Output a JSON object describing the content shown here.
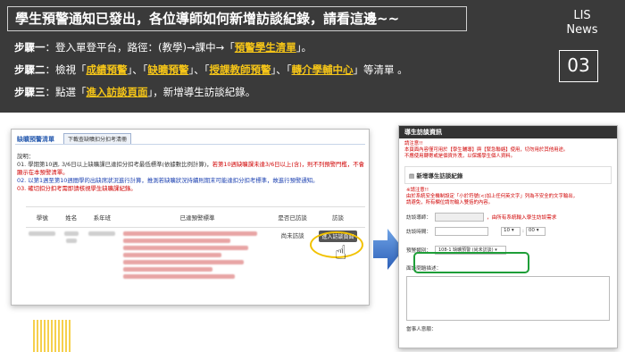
{
  "header": {
    "title": "學生預警通知已發出，各位導師如何新增訪談紀錄，請看這邊~~",
    "brand_line1": "LIS",
    "brand_line2": "News",
    "number": "03"
  },
  "steps": [
    {
      "label": "步驟一",
      "t1": "：登入單登平台，路徑：(教學)→課中→「",
      "h1": "預警學生清單",
      "t2": "」。"
    },
    {
      "label": "步驟二",
      "t1": "：檢視「",
      "h1": "成績預警",
      "t2": "」、「",
      "h2": "缺曠預警",
      "t3": "」、「",
      "h3": "授課教師預警",
      "t4": "」、「",
      "h4": "轉介學輔中心",
      "t5": "」等清單 。"
    },
    {
      "label": "步驟三",
      "t1": "：點選「",
      "h1": "進入訪談頁面",
      "t2": "」，新增導生訪談紀錄。"
    }
  ],
  "left_panel": {
    "tab_label": "缺曠預警清單",
    "download_button": "下載查缺曠扣分扣考清冊",
    "explain_title": "說明：",
    "explain_1a": "01. 學期第10週, 3/6日以上缺曠課已達扣分扣考最低標準(依據數比例計算)，",
    "explain_1b": "若第10週缺曠課未達3/6日以上(含)，則不列預警門檻，不會顯示在本預警清單。",
    "explain_2": "02. 以第1週至第10週間學的出缺席狀況進行計算，推測若缺曠狀況持續則期末可能達扣分扣考標準，故進行預警通知。",
    "explain_3": "03. 確切扣分扣考需即請核視學生缺曠課紀錄。",
    "columns": [
      "學號",
      "姓名",
      "系年班",
      "已達預警標準",
      "是否已訪談",
      "訪談"
    ],
    "row_status": "尚未訪談",
    "enter_button": "進入訪談頁面"
  },
  "right_panel": {
    "title": "導生訪談資訊",
    "note_title": "請注意!!",
    "note_1": "本頁面內容僅可用於【學生輔導】與【緊急聯絡】使用，切勿用於其他用途。",
    "note_2": "不應使用轉寄或是個資外洩，以保護學生個人資料。",
    "section_title": "新增導生訪談紀錄",
    "red_title": "※請注意!!",
    "red_1": "由於系統安全機制設定「小於符號(<)加上任何英文字」列為不安全的文字輸出，",
    "red_2": "請避免，所有欄位請勿輸入雙括的內容。",
    "field_teacher": "訪談導師：",
    "field_teacher_hint": "，由所有系統輸入學生訪談需求",
    "field_time": "訪談時間：",
    "hour": "10",
    "minute": "00",
    "field_category": "預警類別：",
    "category_value": "108-1 缺曠預警 (尚未訪談)",
    "field_content": "面談問題描述：",
    "field_owner": "當事人意願："
  }
}
